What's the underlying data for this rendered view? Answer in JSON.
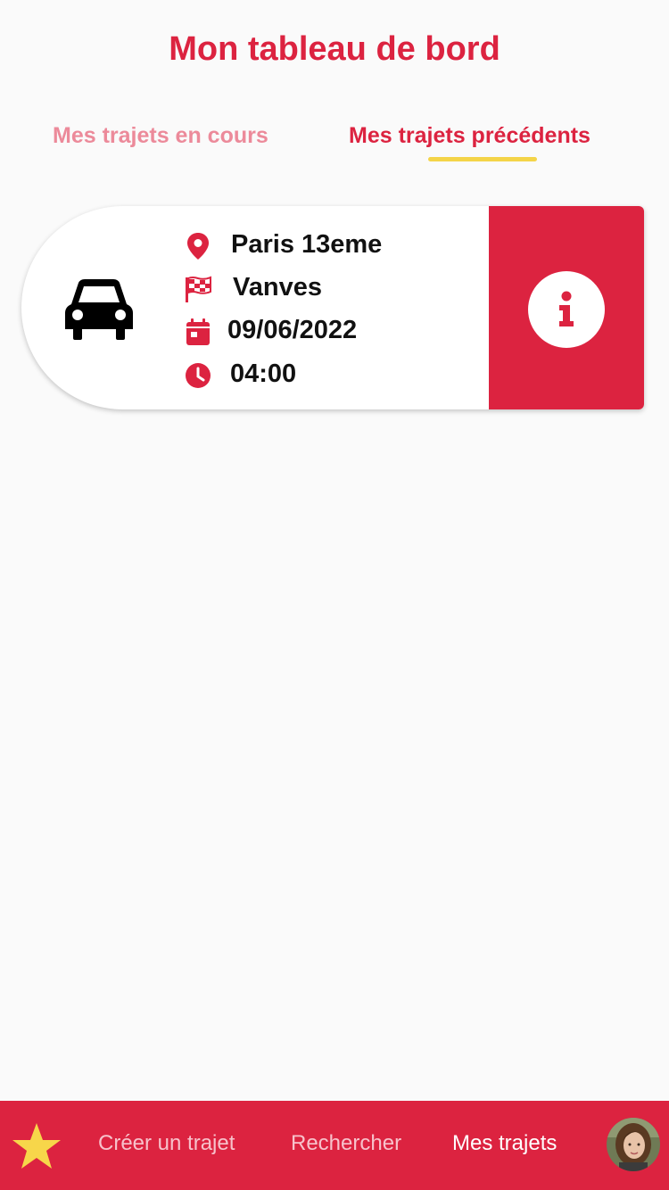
{
  "header": {
    "title": "Mon tableau de bord"
  },
  "tabs": [
    {
      "label": "Mes trajets en cours",
      "active": false
    },
    {
      "label": "Mes trajets précédents",
      "active": true
    }
  ],
  "trips": [
    {
      "vehicle_icon": "car-icon",
      "departure": "Paris 13eme",
      "arrival": "Vanves",
      "date": "09/06/2022",
      "time": "04:00",
      "details_icon": "info-icon"
    }
  ],
  "bottom_nav": {
    "items": [
      {
        "icon": "star-icon"
      },
      {
        "label": "Créer un trajet"
      },
      {
        "label": "Rechercher"
      },
      {
        "label": "Mes trajets",
        "active": true
      },
      {
        "icon": "avatar"
      }
    ]
  },
  "colors": {
    "brand": "#dc2340",
    "tab_inactive": "#ec8a9a",
    "tab_indicator": "#f4d448",
    "nav_inactive": "#f7c2cb",
    "background": "#fafafa"
  }
}
